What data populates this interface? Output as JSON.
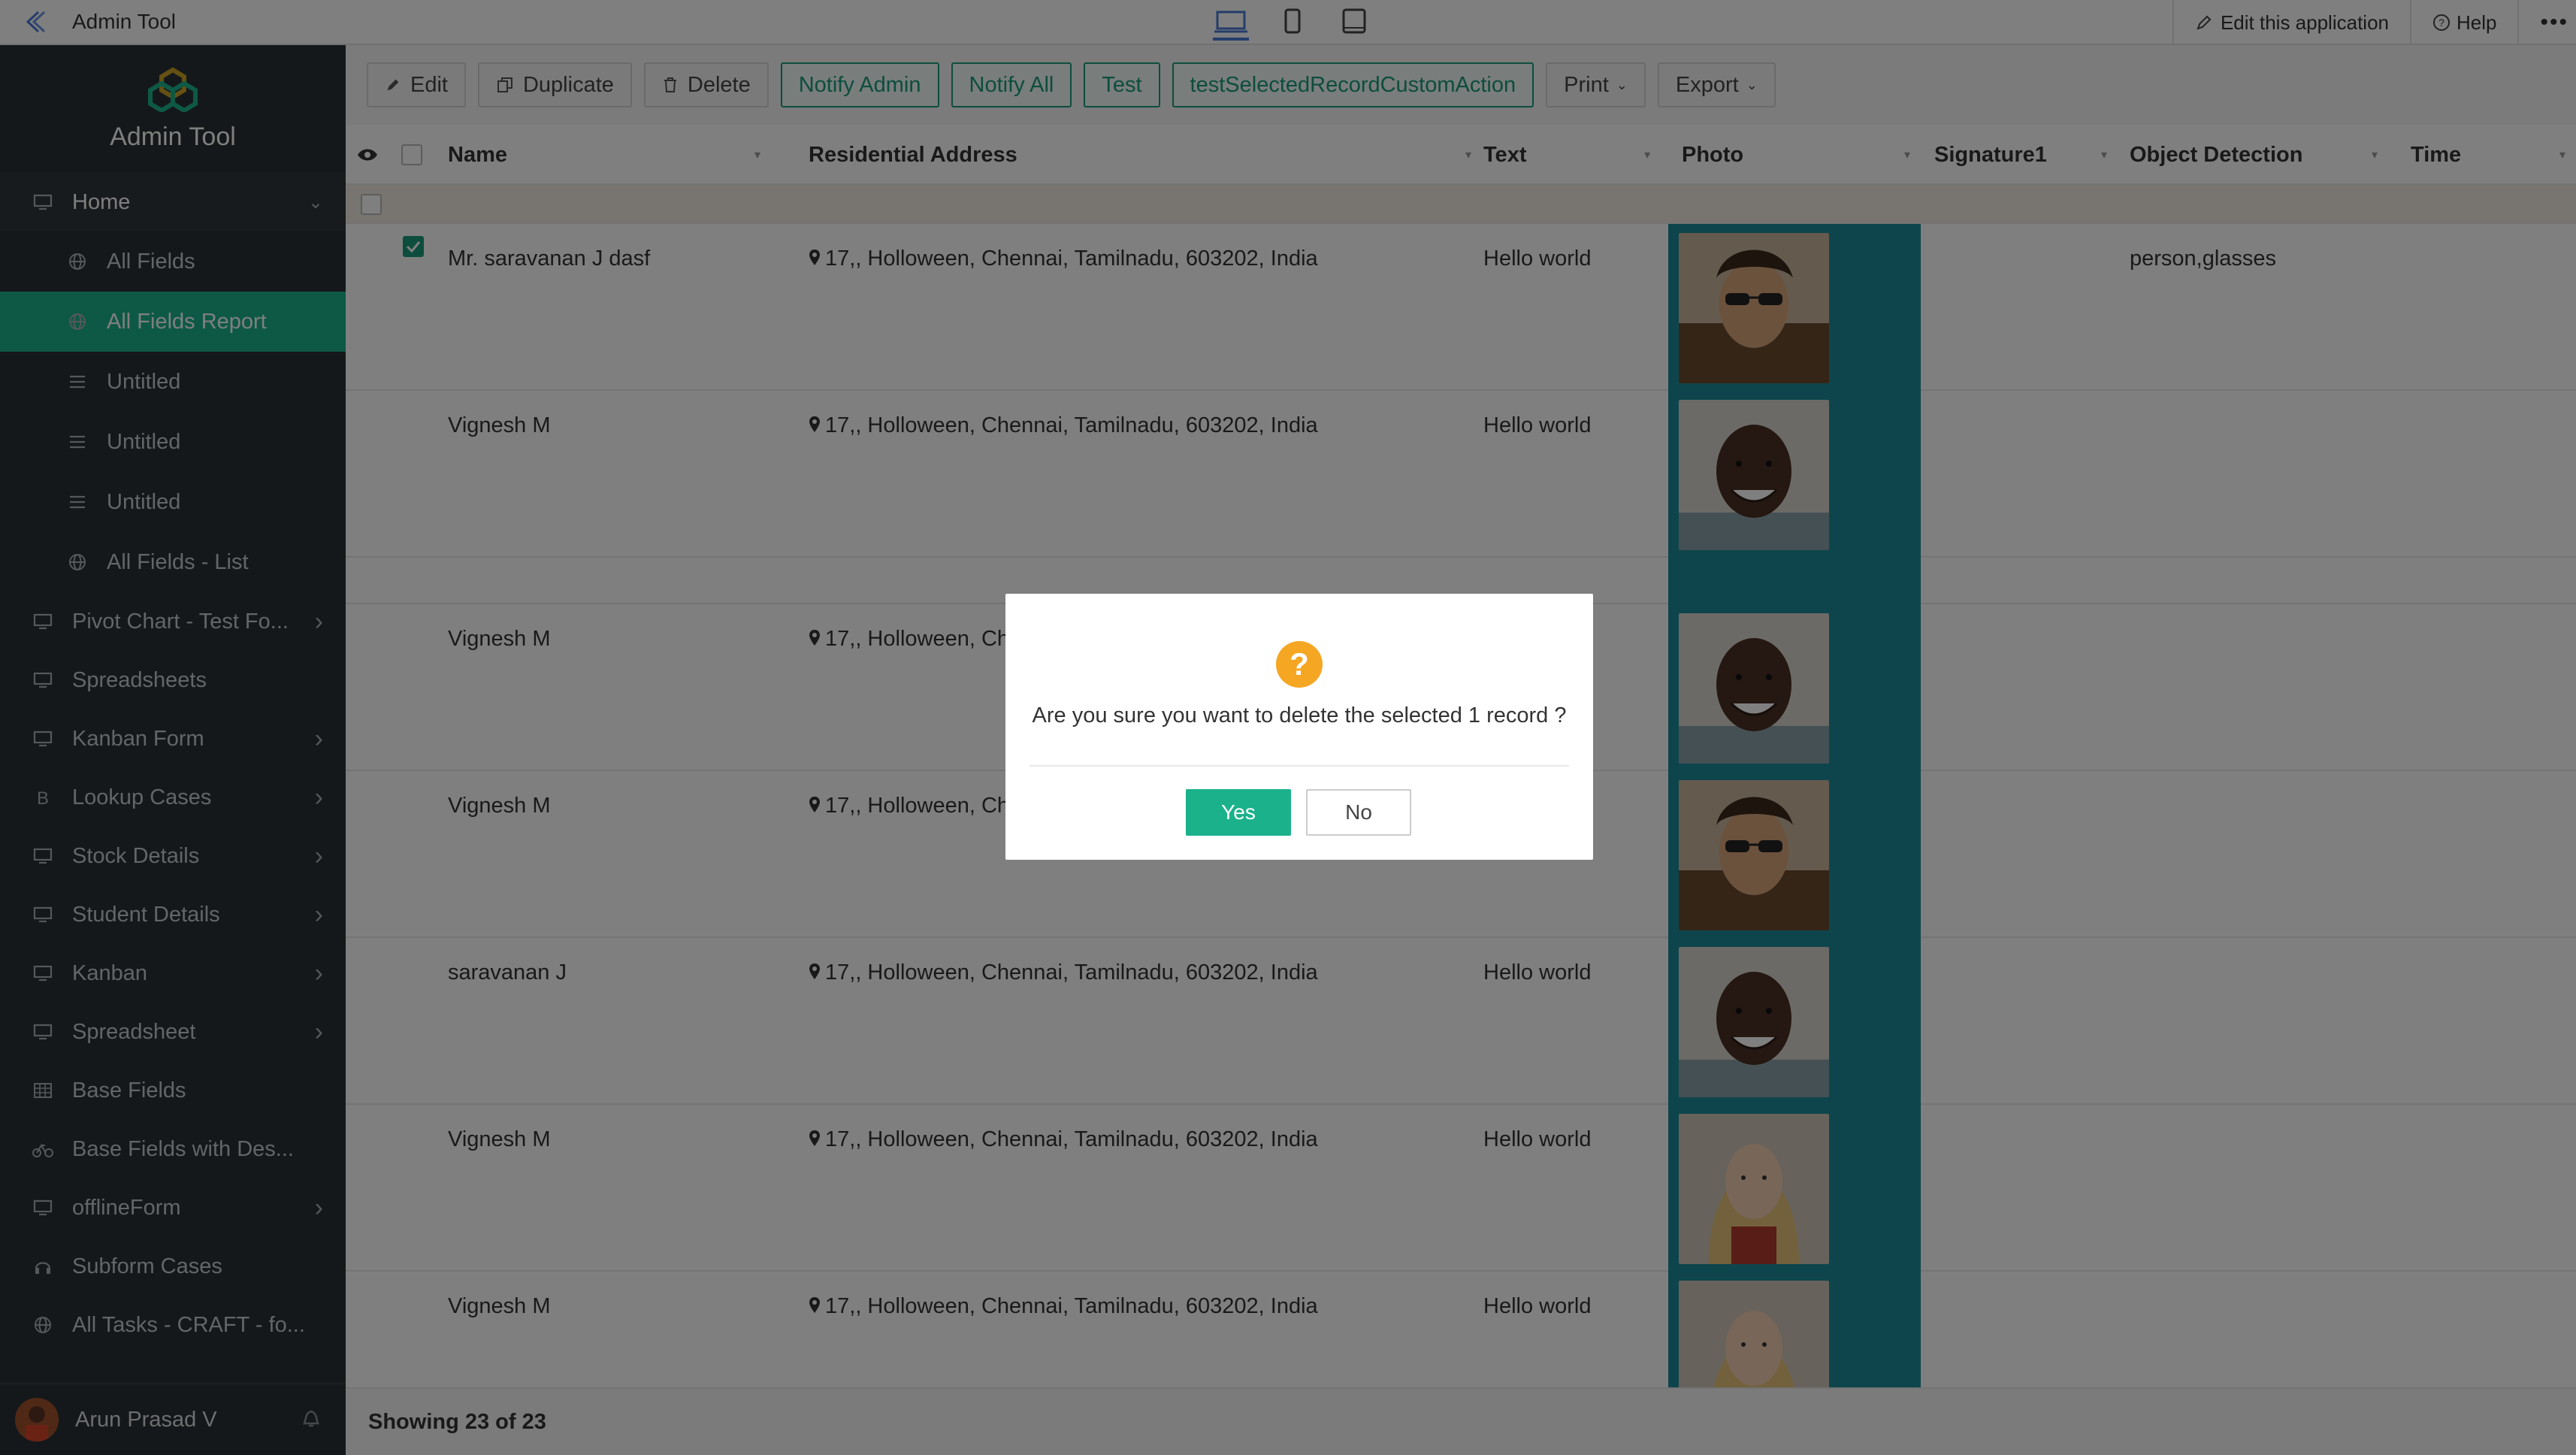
{
  "topbar": {
    "app_title": "Admin Tool",
    "edit_app": "Edit this application",
    "help": "Help"
  },
  "sidebar": {
    "brand": "Admin Tool",
    "items": [
      {
        "label": "Home",
        "icon": "monitor-icon",
        "level": "top",
        "expanded": true
      },
      {
        "label": "All Fields",
        "icon": "globe-icon",
        "level": "sub"
      },
      {
        "label": "All Fields Report",
        "icon": "globe-icon",
        "level": "sub",
        "active": true
      },
      {
        "label": "Untitled",
        "icon": "list-icon",
        "level": "sub"
      },
      {
        "label": "Untitled",
        "icon": "list-icon",
        "level": "sub"
      },
      {
        "label": "Untitled",
        "icon": "list-icon",
        "level": "sub"
      },
      {
        "label": "All Fields - List",
        "icon": "globe-icon",
        "level": "sub"
      },
      {
        "label": "Pivot Chart - Test Fo...",
        "icon": "monitor-icon",
        "level": "top",
        "chevron": true
      },
      {
        "label": "Spreadsheets",
        "icon": "monitor-icon",
        "level": "top"
      },
      {
        "label": "Kanban Form",
        "icon": "monitor-icon",
        "level": "top",
        "chevron": true
      },
      {
        "label": "Lookup Cases",
        "icon": "bitcoin-icon",
        "level": "top",
        "chevron": true
      },
      {
        "label": "Stock Details",
        "icon": "monitor-icon",
        "level": "top",
        "chevron": true
      },
      {
        "label": "Student Details",
        "icon": "monitor-icon",
        "level": "top",
        "chevron": true
      },
      {
        "label": "Kanban",
        "icon": "monitor-icon",
        "level": "top",
        "chevron": true
      },
      {
        "label": "Spreadsheet",
        "icon": "monitor-icon",
        "level": "top",
        "chevron": true
      },
      {
        "label": "Base Fields",
        "icon": "table-icon",
        "level": "top"
      },
      {
        "label": "Base Fields with Des...",
        "icon": "bike-icon",
        "level": "top"
      },
      {
        "label": "offlineForm",
        "icon": "monitor-icon",
        "level": "top",
        "chevron": true
      },
      {
        "label": "Subform Cases",
        "icon": "headphones-icon",
        "level": "top"
      },
      {
        "label": "All Tasks - CRAFT - fo...",
        "icon": "globe-icon",
        "level": "top"
      }
    ],
    "user_name": "Arun Prasad V"
  },
  "toolbar": {
    "edit": "Edit",
    "duplicate": "Duplicate",
    "delete": "Delete",
    "notify_admin": "Notify Admin",
    "notify_all": "Notify All",
    "test": "Test",
    "custom_action": "testSelectedRecordCustomAction",
    "print": "Print",
    "export": "Export"
  },
  "table": {
    "columns": [
      "Name",
      "Residential Address",
      "Text",
      "Photo",
      "Signature1",
      "Object Detection",
      "Time"
    ],
    "rows": [
      {
        "name": "Mr. saravanan J dasf",
        "address": "17,, Holloween, Chennai, Tamilnadu, 603202, India",
        "text": "Hello world",
        "photo": "man-sunglasses",
        "object_detection": "person,glasses",
        "checked": true
      },
      {
        "name": "Vignesh M",
        "address": "17,, Holloween, Chennai, Tamilnadu, 603202, India",
        "text": "Hello world",
        "photo": "man-smiling",
        "object_detection": "",
        "checked": false
      },
      {
        "name": "",
        "address": "",
        "text": "",
        "photo": "",
        "object_detection": "",
        "checked": false
      },
      {
        "name": "Vignesh M",
        "address": "17,, Holloween, Ch",
        "text": "",
        "photo": "man-smiling",
        "object_detection": "",
        "checked": false
      },
      {
        "name": "Vignesh M",
        "address": "17,, Holloween, Ch",
        "text": "",
        "photo": "man-sunglasses",
        "object_detection": "",
        "checked": false
      },
      {
        "name": "saravanan J",
        "address": "17,, Holloween, Chennai, Tamilnadu, 603202, India",
        "text": "Hello world",
        "photo": "man-smiling",
        "object_detection": "",
        "checked": false
      },
      {
        "name": "Vignesh M",
        "address": "17,, Holloween, Chennai, Tamilnadu, 603202, India",
        "text": "Hello world",
        "photo": "woman-blonde",
        "object_detection": "",
        "checked": false
      },
      {
        "name": "Vignesh M",
        "address": "17,, Holloween, Chennai, Tamilnadu, 603202, India",
        "text": "Hello world",
        "photo": "woman-blonde",
        "object_detection": "",
        "checked": false
      }
    ],
    "status": "Showing 23 of 23"
  },
  "dialog": {
    "message": "Are you sure you want to delete the selected 1 record ?",
    "yes": "Yes",
    "no": "No"
  },
  "colors": {
    "accent": "#1bb28b",
    "sidebar_bg": "#2a3035",
    "photo_col_bg": "#1d8a99"
  }
}
